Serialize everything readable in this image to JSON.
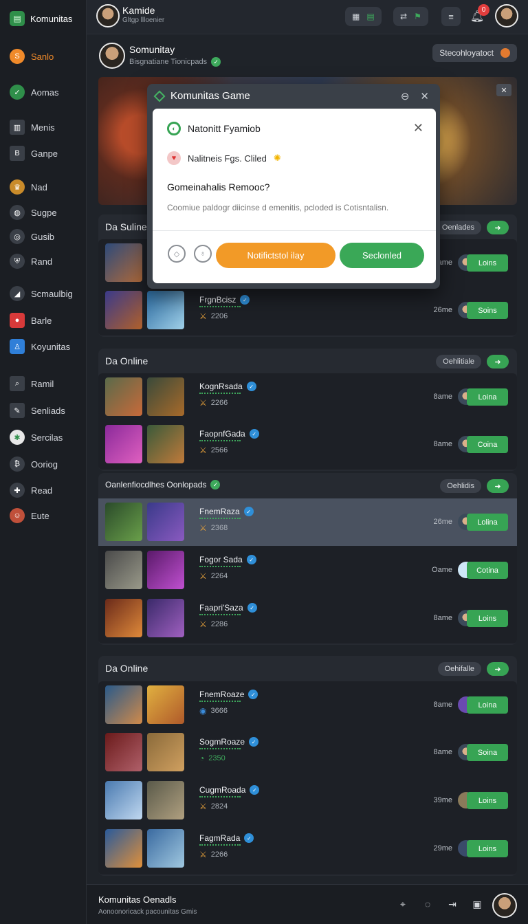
{
  "app": {
    "brand": "Komunitas",
    "brand_icon": "community-icon"
  },
  "sidebar": {
    "items": [
      {
        "label": "Sanlo",
        "icon": "home-icon",
        "active": true
      },
      {
        "label": "Aomas",
        "icon": "check-icon"
      },
      {
        "label": "Menis",
        "icon": "chart-icon"
      },
      {
        "label": "Ganpe",
        "icon": "book-icon"
      },
      {
        "label": "Nad",
        "icon": "trophy-icon"
      },
      {
        "label": "Sugpe",
        "icon": "chat-icon"
      },
      {
        "label": "Gusib",
        "icon": "target-icon"
      },
      {
        "label": "Rand",
        "icon": "shield-icon"
      },
      {
        "label": "Scmaulbig",
        "icon": "megaphone-icon"
      },
      {
        "label": "Barle",
        "icon": "record-icon"
      },
      {
        "label": "Koyunitas",
        "icon": "people-icon"
      },
      {
        "label": "Ramil",
        "icon": "search-icon"
      },
      {
        "label": "Senliads",
        "icon": "edit-icon"
      },
      {
        "label": "Sercilas",
        "icon": "star-icon"
      },
      {
        "label": "Ooriog",
        "icon": "coin-icon"
      },
      {
        "label": "Read",
        "icon": "gamepad-icon"
      },
      {
        "label": "Eute",
        "icon": "avatar-icon"
      }
    ]
  },
  "topbar": {
    "user_name": "Kamide",
    "user_sub": "Gltgp llloenier",
    "notification_count": "0"
  },
  "header": {
    "title": "Somunitay",
    "subtitle": "Bisgnatiane Tionicpads",
    "button": "Stecohloyatoct"
  },
  "dialog": {
    "outer_title": "Komunitas Game",
    "line1": "Natonitt Fyamiob",
    "line2": "Nalitneis Fgs. Cliled",
    "title": "Gomeinahalis Remooc?",
    "body": "Coomiue paldogr diicinse d emenitis, pcloded is Cotisntalisn.",
    "primary": "Notifictstol ilay",
    "secondary": "Seclonled"
  },
  "sections": [
    {
      "title": "Da Suline",
      "pill": "Oenlades",
      "rows": [
        {
          "title": "",
          "score": "",
          "meta": "9ame",
          "button": "Loins"
        },
        {
          "title": "FrgnBcisz",
          "score": "2206",
          "meta": "26me",
          "button": "Soins"
        }
      ]
    },
    {
      "title": "Da Online",
      "pill": "Oehlitiale",
      "rows": [
        {
          "title": "KognRsada",
          "score": "2266",
          "meta": "8ame",
          "button": "Loina"
        },
        {
          "title": "FaopnfGada",
          "score": "2566",
          "meta": "8ame",
          "button": "Coina"
        }
      ]
    },
    {
      "title": "Oanlenfiocdlhes Oonlopads",
      "pill": "Oehlidis",
      "rows": [
        {
          "title": "FnemRaza",
          "score": "2368",
          "meta": "26me",
          "button": "Lolina",
          "highlight": true
        },
        {
          "title": "Fogor Sada",
          "score": "2264",
          "meta": "Oame",
          "button": "Cotina"
        },
        {
          "title": "Faapri'Saza",
          "score": "2286",
          "meta": "8ame",
          "button": "Loins"
        }
      ]
    },
    {
      "title": "Da Online",
      "pill": "Oehifalle",
      "rows": [
        {
          "title": "FnemRoaze",
          "score": "3666",
          "meta": "8ame",
          "button": "Loina"
        },
        {
          "title": "SogmRoaze",
          "score": "2350",
          "meta": "8ame",
          "button": "Soina"
        },
        {
          "title": "CugmRoada",
          "score": "2824",
          "meta": "39me",
          "button": "Loins"
        },
        {
          "title": "FagmRada",
          "score": "2266",
          "meta": "29me",
          "button": "Loins"
        }
      ]
    }
  ],
  "footer": {
    "title": "Komunitas Oenadls",
    "sub": "Aonoonoricack pacounitas Gmis"
  },
  "colors": {
    "accent": "#f29a27",
    "brand_green": "#37a454",
    "background": "#1f2329"
  }
}
